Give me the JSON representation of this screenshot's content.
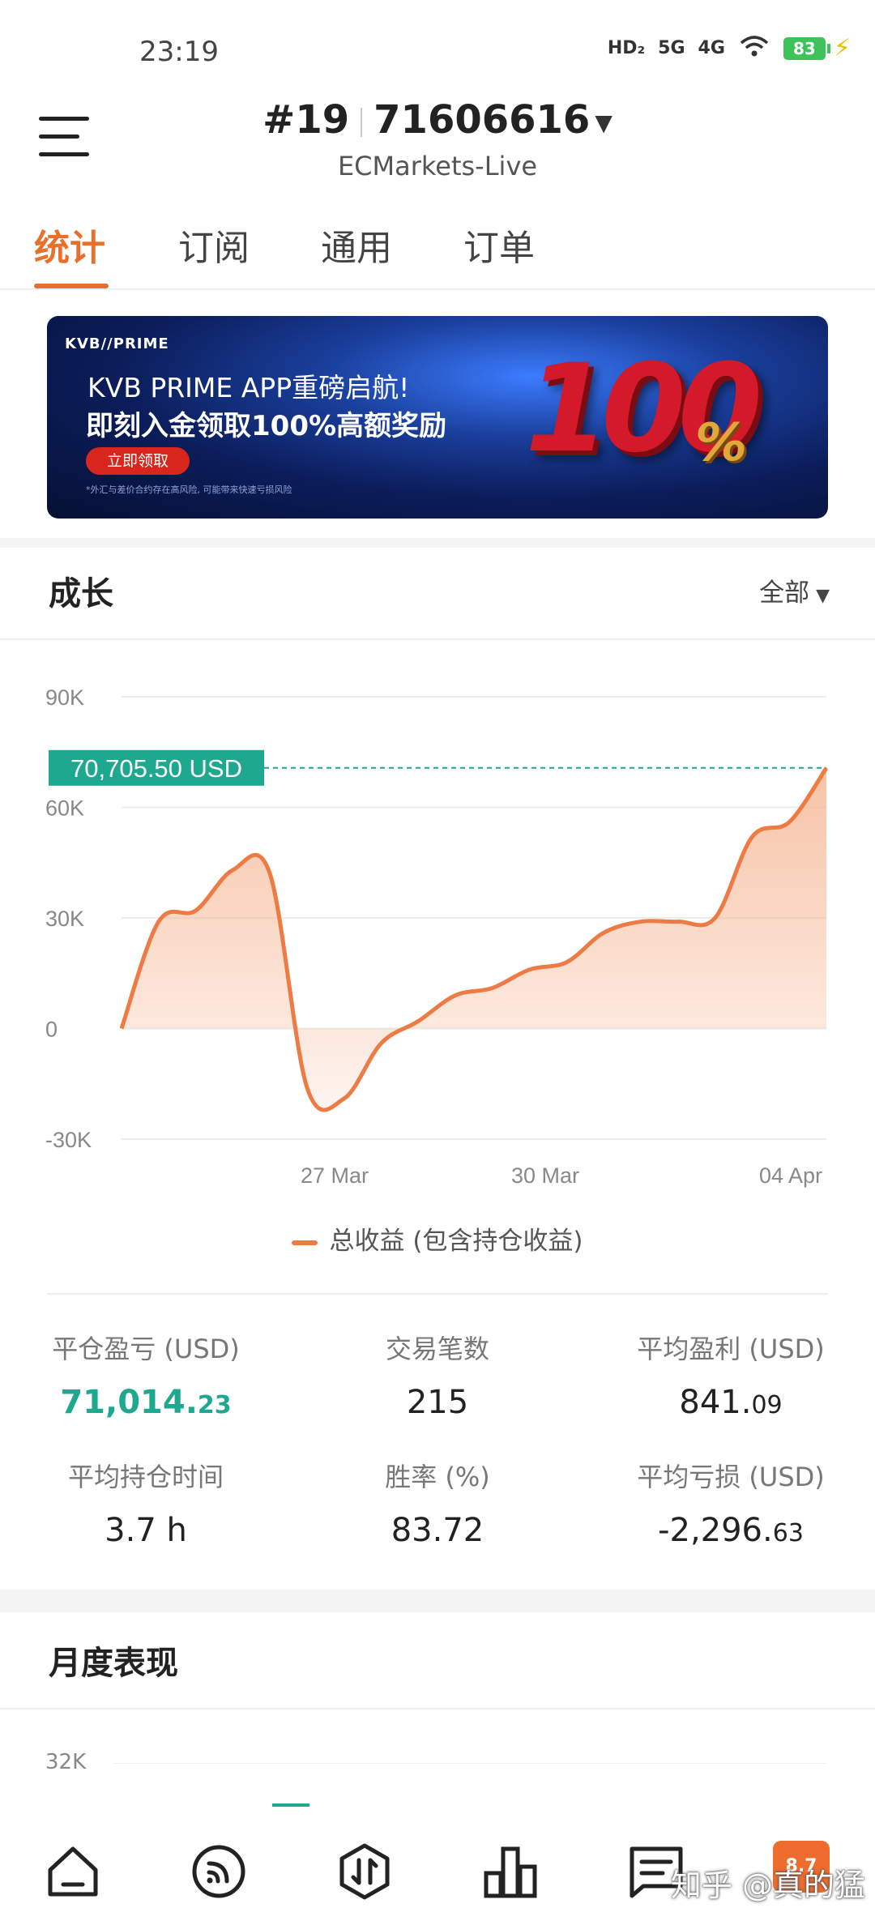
{
  "status_bar": {
    "time": "23:19",
    "signal1": "HD₂",
    "signal2": "5G",
    "signal3": "4G",
    "battery": "83"
  },
  "header": {
    "account_prefix": "#19",
    "account_number": "71606616",
    "server": "ECMarkets-Live"
  },
  "tabs": [
    {
      "label": "统计"
    },
    {
      "label": "订阅"
    },
    {
      "label": "通用"
    },
    {
      "label": "订单"
    }
  ],
  "banner": {
    "brand": "KVB//PRIME",
    "line1": "KVB PRIME APP重磅启航!",
    "line2": "即刻入金领取100%高额奖励",
    "cta": "立即领取",
    "disclaimer": "*外汇与差价合约存在高风险, 可能带来快速亏损风险",
    "big_number": "100",
    "percent": "%"
  },
  "growth": {
    "title": "成长",
    "range": "全部"
  },
  "chart_data": {
    "type": "area",
    "y_ticks": [
      "90K",
      "60K",
      "30K",
      "0",
      "-30K"
    ],
    "ylim": [
      -30000,
      90000
    ],
    "x_ticks": [
      "27 Mar",
      "30 Mar",
      "04 Apr"
    ],
    "current_label": "70,705.50 USD",
    "current_value": 70705.5,
    "series": [
      {
        "name": "总收益 (包含持仓收益)",
        "values": [
          0,
          29000,
          32000,
          43000,
          42000,
          -16000,
          -19000,
          -4000,
          2000,
          9000,
          11000,
          16000,
          18000,
          26000,
          29000,
          29000,
          30000,
          52000,
          56000,
          70705
        ]
      }
    ],
    "colors": {
      "line": "#ee7a44",
      "fill_top": "#f6b896",
      "current": "#1ea890"
    }
  },
  "stats": {
    "closed_pnl_label": "平仓盈亏 (USD)",
    "closed_pnl_int": "71,014.",
    "closed_pnl_dec": "23",
    "trades_label": "交易笔数",
    "trades": "215",
    "avg_profit_label": "平均盈利 (USD)",
    "avg_profit_int": "841.",
    "avg_profit_dec": "09",
    "avg_hold_label": "平均持仓时间",
    "avg_hold": "3.7 h",
    "winrate_label": "胜率 (%)",
    "winrate": "83.72",
    "avg_loss_label": "平均亏损 (USD)",
    "avg_loss_int": "-2,296.",
    "avg_loss_dec": "63"
  },
  "monthly": {
    "title": "月度表现",
    "top_tick": "32K"
  },
  "bottom_nav": {
    "chip": "8.7",
    "watermark": "知乎 @真的猛"
  }
}
